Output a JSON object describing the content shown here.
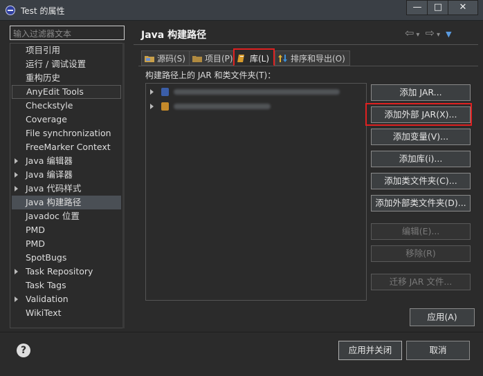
{
  "window": {
    "title": "Test 的属性",
    "minimize": "—",
    "maximize": "□",
    "close": "✕"
  },
  "filter": {
    "placeholder": "输入过滤器文本"
  },
  "nav": {
    "items": [
      {
        "label": "项目引用",
        "expandable": false
      },
      {
        "label": "运行 / 调试设置",
        "expandable": false
      },
      {
        "label": "重构历史",
        "expandable": false
      },
      {
        "label": "AnyEdit Tools",
        "expandable": false
      },
      {
        "label": "Checkstyle",
        "expandable": false
      },
      {
        "label": "Coverage",
        "expandable": false
      },
      {
        "label": "File synchronization",
        "expandable": false
      },
      {
        "label": "FreeMarker Context",
        "expandable": false
      },
      {
        "label": "Java 编辑器",
        "expandable": true
      },
      {
        "label": "Java 编译器",
        "expandable": true
      },
      {
        "label": "Java 代码样式",
        "expandable": true
      },
      {
        "label": "Java 构建路径",
        "expandable": false
      },
      {
        "label": "Javadoc 位置",
        "expandable": false
      },
      {
        "label": "PMD",
        "expandable": false
      },
      {
        "label": "PMD",
        "expandable": false
      },
      {
        "label": "SpotBugs",
        "expandable": false
      },
      {
        "label": "Task Repository",
        "expandable": true
      },
      {
        "label": "Task Tags",
        "expandable": false
      },
      {
        "label": "Validation",
        "expandable": true
      },
      {
        "label": "WikiText",
        "expandable": false
      }
    ],
    "selected": "Java 构建路径",
    "highlighted": "AnyEdit Tools"
  },
  "header": {
    "title": "Java 构建路径",
    "back": "⇦",
    "forward": "⇨",
    "dropdown": "▾",
    "menu": "▼"
  },
  "tabs": [
    {
      "label": "源码(S)",
      "active": false
    },
    {
      "label": "项目(P)",
      "active": false
    },
    {
      "label": "库(L)",
      "active": true
    },
    {
      "label": "排序和导出(O)",
      "active": false
    }
  ],
  "libraries": {
    "label": "构建路径上的 JAR 和类文件夹(T)："
  },
  "buttons": {
    "add_jar": "添加 JAR...",
    "add_external_jar": "添加外部 JAR(X)...",
    "add_variable": "添加变量(V)...",
    "add_library": "添加库(i)...",
    "add_class_folder": "添加类文件夹(C)...",
    "add_external_class_folder": "添加外部类文件夹(D)...",
    "edit": "编辑(E)...",
    "remove": "移除(R)",
    "migrate_jar": "迁移 JAR 文件...",
    "apply": "应用(A)",
    "apply_close": "应用并关闭",
    "cancel": "取消",
    "help": "?"
  },
  "colors": {
    "highlight_red": "#e02020",
    "background": "#2b2b2b"
  }
}
